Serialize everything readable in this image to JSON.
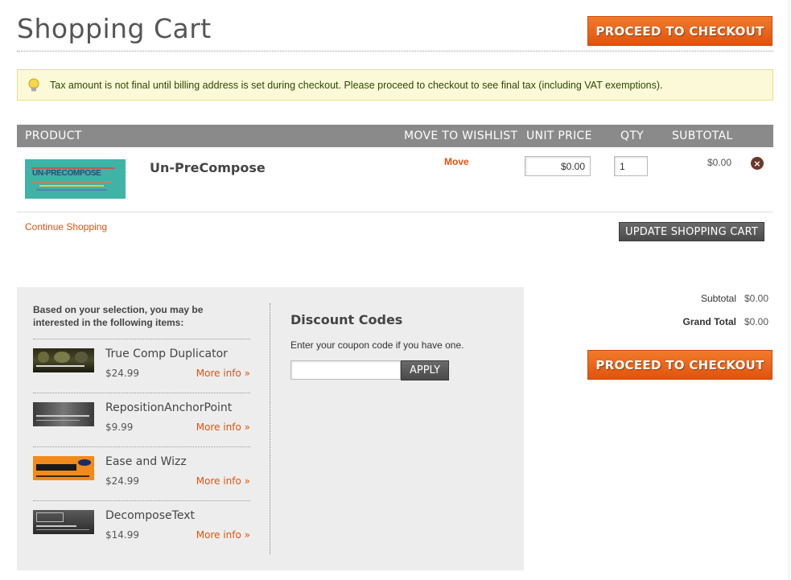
{
  "page": {
    "title": "Shopping Cart",
    "checkout_label": "PROCEED TO CHECKOUT"
  },
  "notice": {
    "text": "Tax amount is not final until billing address is set during checkout. Please proceed to checkout to see final tax (including VAT exemptions)."
  },
  "cart": {
    "headers": {
      "product": "PRODUCT",
      "wishlist": "MOVE TO WISHLIST",
      "unit_price": "UNIT PRICE",
      "qty": "QTY",
      "subtotal": "SUBTOTAL"
    },
    "items": [
      {
        "thumb_text": "UN-PRECOMPOSE",
        "name": "Un-PreCompose",
        "move_label": "Move",
        "unit_price": "$0.00",
        "qty": "1",
        "subtotal": "$0.00",
        "remove_icon": "x-circle-icon"
      }
    ],
    "continue_label": "Continue Shopping",
    "update_label": "UPDATE SHOPPING CART"
  },
  "suggestions": {
    "title": "Based on your selection, you may be interested in the following items:",
    "items": [
      {
        "name": "True Comp Duplicator",
        "price": "$24.99",
        "more": "More info »"
      },
      {
        "name": "RepositionAnchorPoint",
        "price": "$9.99",
        "more": "More info »"
      },
      {
        "name": "Ease and Wizz",
        "price": "$24.99",
        "more": "More info »"
      },
      {
        "name": "DecomposeText",
        "price": "$14.99",
        "more": "More info »"
      }
    ]
  },
  "discount": {
    "title": "Discount Codes",
    "description": "Enter your coupon code if you have one.",
    "coupon_value": "",
    "apply_label": "APPLY"
  },
  "totals": {
    "subtotal_label": "Subtotal",
    "subtotal_value": "$0.00",
    "grand_label": "Grand Total",
    "grand_value": "$0.00"
  },
  "colors": {
    "accent": "#e0530e",
    "header_bg": "#8a8a8a",
    "notice_bg": "#fbf9d8"
  }
}
